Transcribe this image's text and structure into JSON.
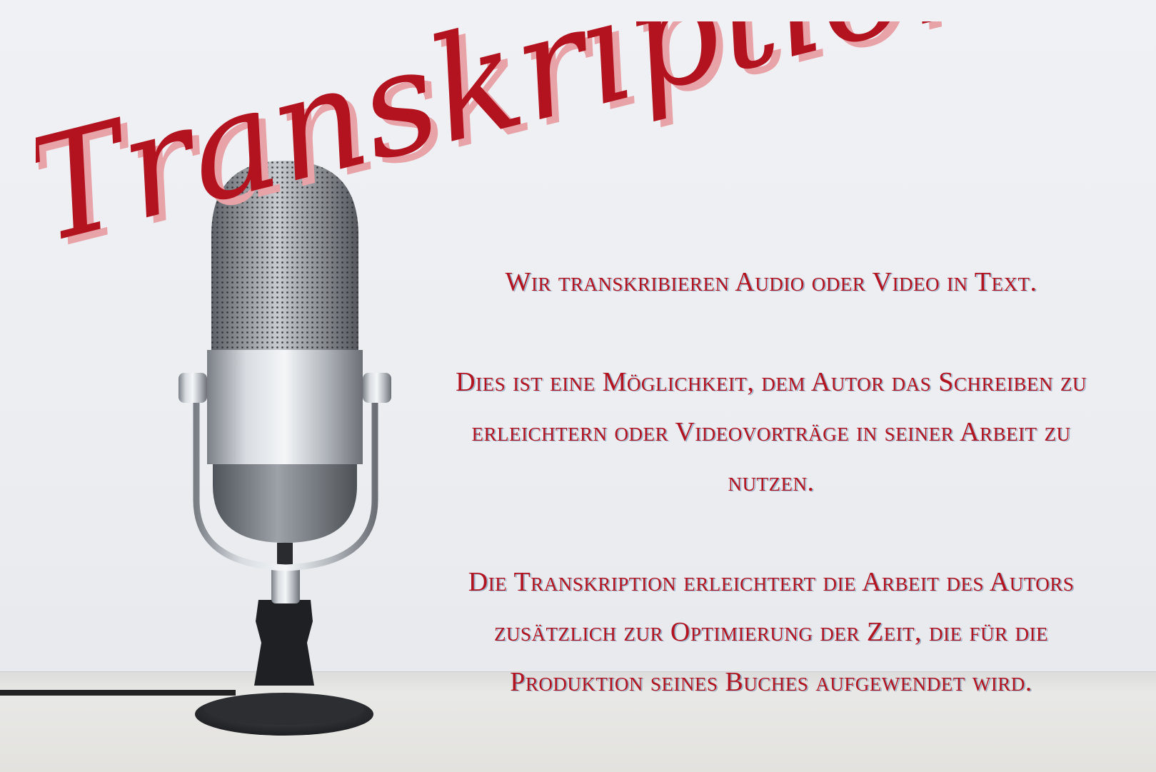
{
  "title": "Transkription",
  "paragraphs": [
    "Wir transkribieren Audio oder Video in Text.",
    "Dies ist eine Möglichkeit, dem Autor das Schreiben zu erleichtern oder Videovorträge in seiner Arbeit zu nutzen.",
    "Die Transkription erleichtert die Arbeit des Autors zusätzlich zur Optimierung der Zeit, die für die Produktion seines Buches aufgewendet wird."
  ],
  "colors": {
    "text": "#b3131f",
    "shadow": "#e7a3a8",
    "background": "#eef0f3"
  },
  "icons": {
    "microphone": "microphone-icon"
  }
}
